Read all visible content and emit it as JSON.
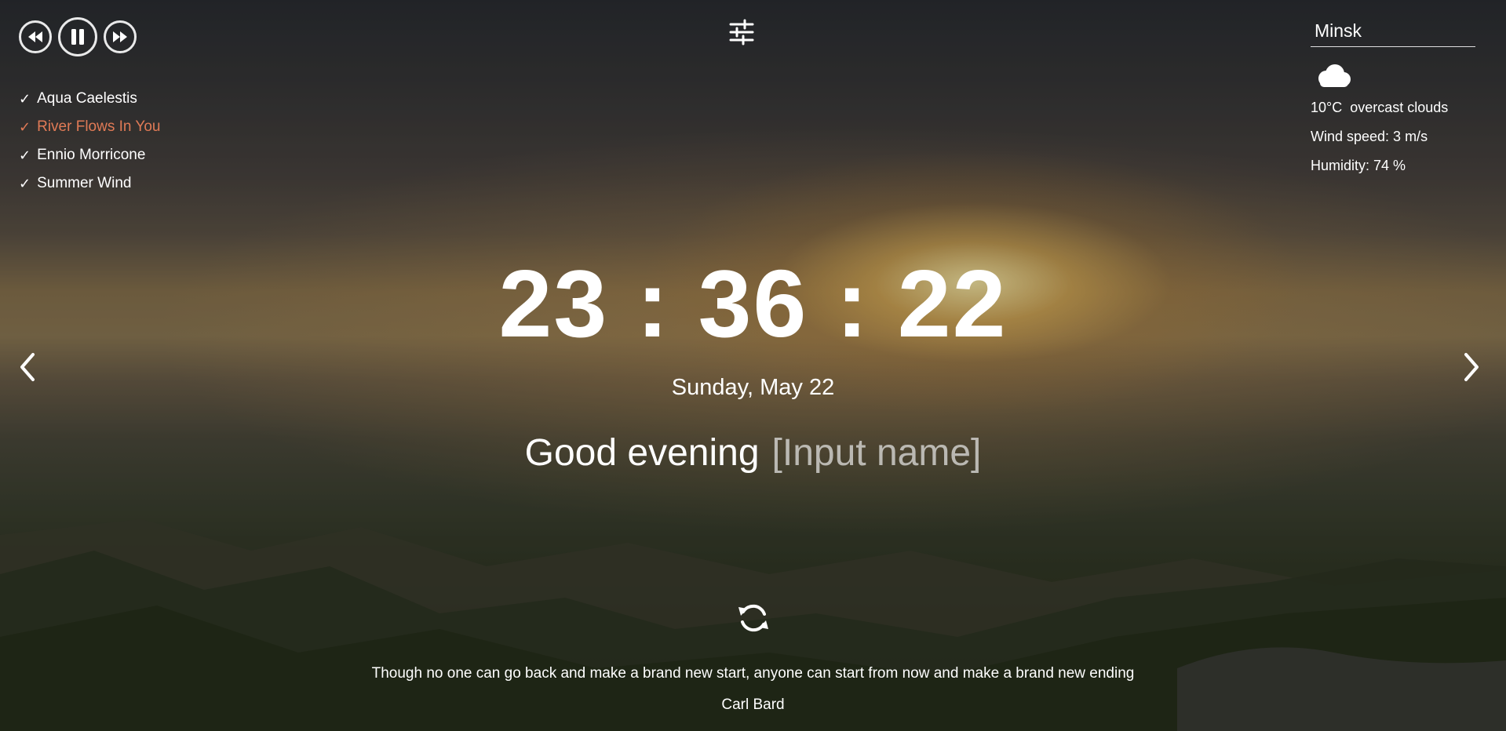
{
  "player": {
    "prev_icon": "rewind-icon",
    "pause_icon": "pause-icon",
    "next_icon": "fast-forward-icon",
    "playlist": [
      {
        "title": "Aqua Caelestis",
        "active": false
      },
      {
        "title": "River Flows In You",
        "active": true
      },
      {
        "title": "Ennio Morricone",
        "active": false
      },
      {
        "title": "Summer Wind",
        "active": false
      }
    ],
    "active_color": "#e07a56"
  },
  "settings_icon": "sliders-icon",
  "weather": {
    "city": "Minsk",
    "icon": "cloud-icon",
    "temperature": "10°C",
    "description": "overcast clouds",
    "wind": "Wind speed: 3 m/s",
    "humidity": "Humidity: 74 %"
  },
  "slider": {
    "prev_icon": "chevron-left-icon",
    "next_icon": "chevron-right-icon"
  },
  "clock": {
    "time": "23 : 36 : 22",
    "date": "Sunday, May 22"
  },
  "greeting": {
    "text": "Good evening",
    "name_placeholder": "[Input name]"
  },
  "quote": {
    "refresh_icon": "refresh-icon",
    "text": "Though no one can go back and make a brand new start, anyone can start from now and make a brand new ending",
    "author": "Carl Bard"
  }
}
